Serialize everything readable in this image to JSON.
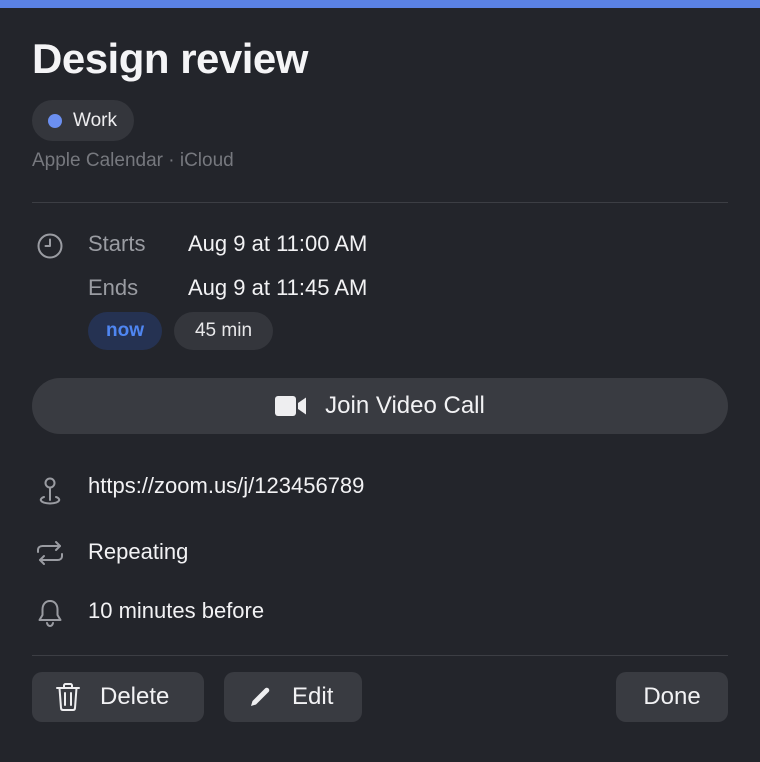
{
  "event": {
    "title": "Design review",
    "calendar_tag": "Work",
    "calendar_color": "#6b8ff0",
    "accent_color": "#5b82e4",
    "source": "Apple Calendar · iCloud"
  },
  "time": {
    "starts_label": "Starts",
    "starts_value": "Aug 9 at 11:00 AM",
    "ends_label": "Ends",
    "ends_value": "Aug 9 at 11:45 AM",
    "status_pill": "now",
    "duration_pill": "45 min"
  },
  "join_button": {
    "label": "Join Video Call",
    "icon": "video-camera-icon"
  },
  "details": {
    "location": "https://zoom.us/j/123456789",
    "location_icon": "location-pin-icon",
    "recurrence": "Repeating",
    "recurrence_icon": "repeat-icon",
    "alert": "10 minutes before",
    "alert_icon": "bell-icon"
  },
  "actions": {
    "delete_label": "Delete",
    "edit_label": "Edit",
    "done_label": "Done"
  }
}
